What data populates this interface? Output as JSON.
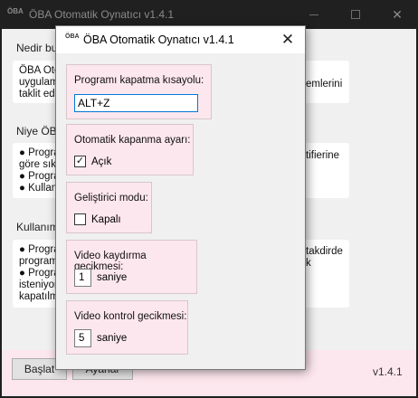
{
  "main_window": {
    "title": "ÖBA Otomatik Oynatıcı v1.4.1",
    "logo": "ÖBA",
    "sections": [
      {
        "label": "Nedir bu",
        "card_left": "ÖBA Oto\nuygulam\ntaklit ed",
        "card_right": "emlerini"
      },
      {
        "label": "Niye ÖBA",
        "card_left": "● Progra\ngöre sıkı\n● Progra\n● Kullanı",
        "card_right": "tifierine"
      },
      {
        "label": "Kullanım",
        "card_left": "● Progra\nprogram\n● Progra\nisteniyor\nkapatılm",
        "card_right": "takdirde\nk"
      }
    ],
    "footer": {
      "start_button": "Başlat",
      "settings_button": "Ayarlar",
      "version": "v1.4.1"
    }
  },
  "dialog": {
    "title": "ÖBA Otomatik Oynatıcı v1.4.1",
    "logo": "ÖBA",
    "shortcut": {
      "label": "Programı kapatma kısayolu:",
      "value": "ALT+Z"
    },
    "auto_close": {
      "label": "Otomatik kapanma ayarı:",
      "checked": true,
      "state_label": "Açık"
    },
    "dev_mode": {
      "label": "Geliştirici modu:",
      "checked": false,
      "state_label": "Kapalı"
    },
    "scroll_delay": {
      "label": "Video kaydırma gecikmesi:",
      "value": "1",
      "unit": "saniye"
    },
    "control_delay": {
      "label": "Video kontrol gecikmesi:",
      "value": "5",
      "unit": "saniye"
    }
  },
  "icons": {
    "check": "✓",
    "close": "✕"
  },
  "colors": {
    "group_bg": "#fde7ee",
    "footer_bg": "#fde7ee",
    "focus_border": "#0078d7",
    "dark_frame": "#1f1f1f"
  }
}
